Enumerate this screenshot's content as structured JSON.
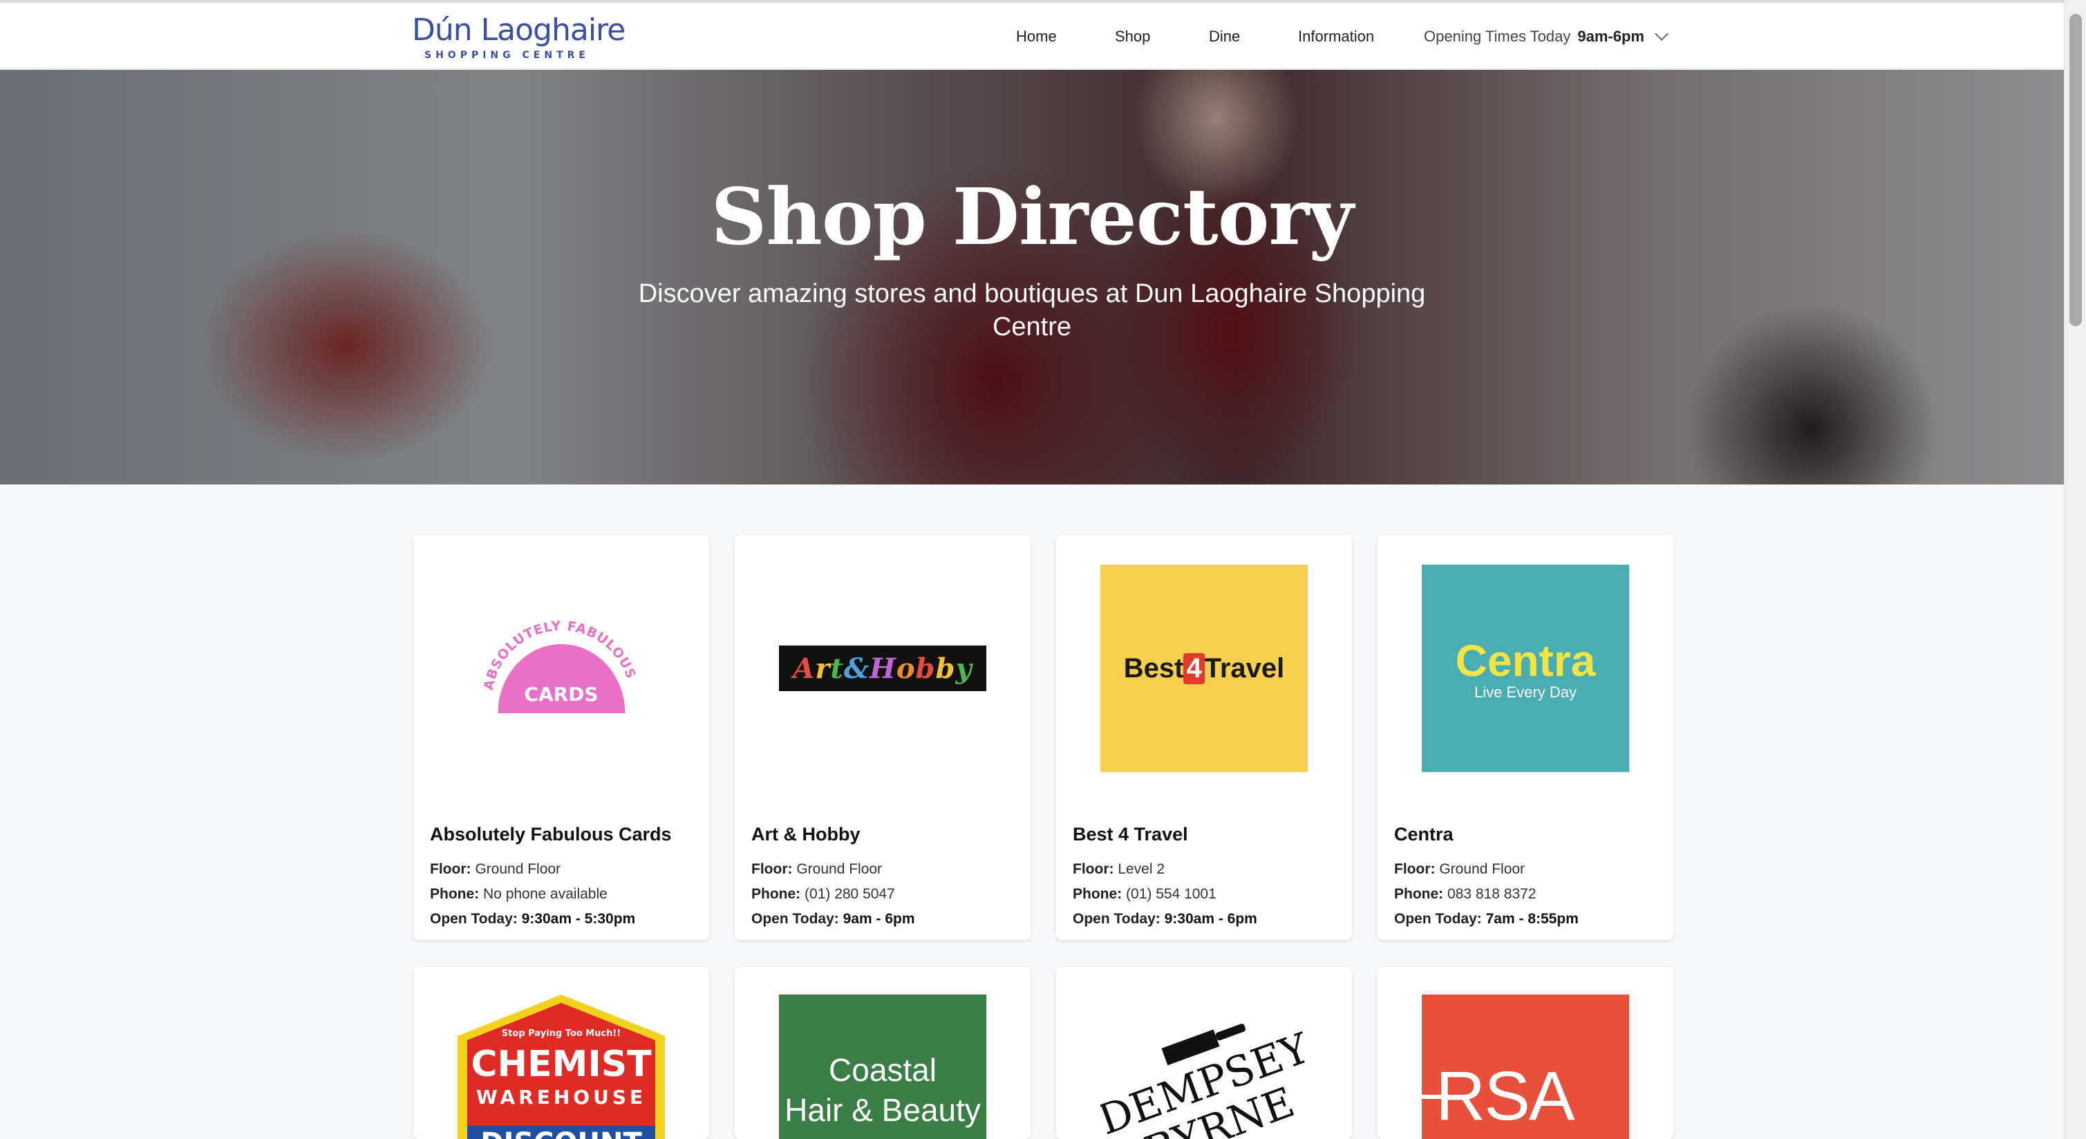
{
  "header": {
    "logo_main": "Dún Laoghaire",
    "logo_sub": "SHOPPING CENTRE",
    "nav": [
      "Home",
      "Shop",
      "Dine",
      "Information"
    ],
    "hours_label": "Opening Times Today",
    "hours_value": "9am-6pm"
  },
  "hero": {
    "title": "Shop Directory",
    "subtitle": "Discover amazing stores and boutiques at Dun Laoghaire Shopping Centre"
  },
  "labels": {
    "floor": "Floor:",
    "phone": "Phone:",
    "open": "Open Today:"
  },
  "shops": [
    {
      "name": "Absolutely Fabulous Cards",
      "floor": "Ground Floor",
      "phone": "No phone available",
      "hours": "9:30am - 5:30pm",
      "logo_text": "ABSOLUTELY FABULOUS",
      "logo_text2": "CARDS",
      "logo_color": "#ea6fc6"
    },
    {
      "name": "Art & Hobby",
      "floor": "Ground Floor",
      "phone": "(01) 280 5047",
      "hours": "9am - 6pm",
      "logo_text": "Art&Hobby"
    },
    {
      "name": "Best 4 Travel",
      "floor": "Level 2",
      "phone": "(01) 554 1001",
      "hours": "9:30am - 6pm",
      "logo_text_a": "Best",
      "logo_text_b": "4",
      "logo_text_c": "Travel",
      "logo_color": "#f5cf4d"
    },
    {
      "name": "Centra",
      "floor": "Ground Floor",
      "phone": "083 818 8372",
      "hours": "7am - 8:55pm",
      "logo_text": "Centra",
      "logo_sub": "Live Every Day",
      "logo_color": "#4aadb3"
    }
  ],
  "shops_row2": [
    {
      "logo_tagline": "Stop Paying Too Much!!",
      "logo_text": "CHEMIST",
      "logo_text2": "WAREHOUSE",
      "logo_text3": "DISCOUNT"
    },
    {
      "logo_text": "Coastal",
      "logo_text2": "Hair & Beauty",
      "logo_color": "#3a7d45"
    },
    {
      "logo_text": "DEMPSEY",
      "logo_text2": "BYRNE"
    },
    {
      "logo_text": "RSA",
      "logo_color": "#e8503e"
    }
  ]
}
